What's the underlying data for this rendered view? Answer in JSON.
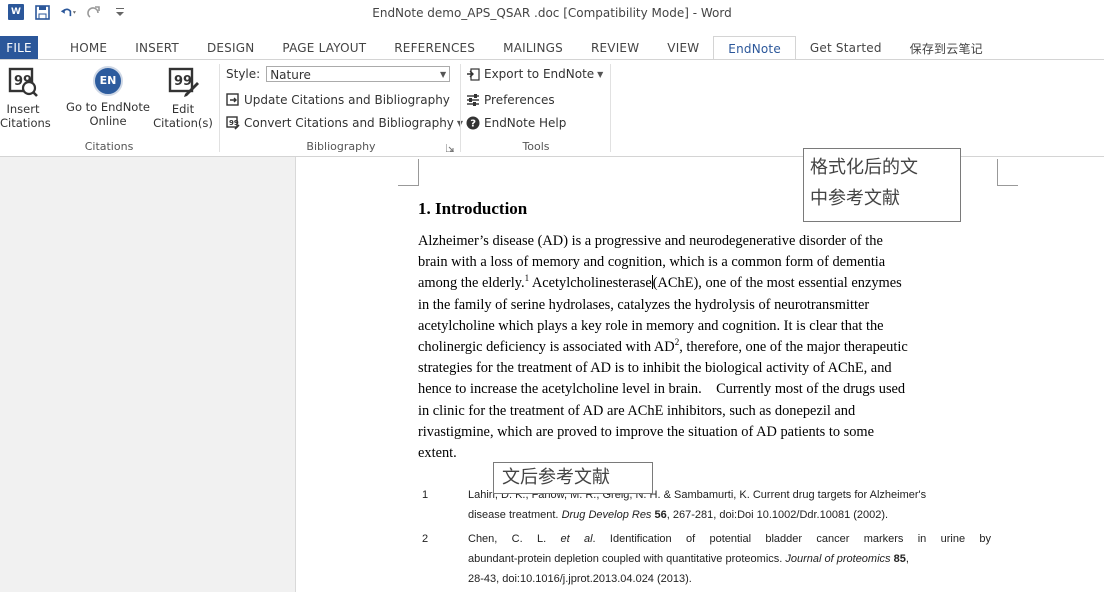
{
  "window": {
    "title": "EndNote demo_APS_QSAR .doc [Compatibility Mode] - Word",
    "app_badge": "W",
    "qat_icons": [
      "save-icon",
      "undo-icon",
      "redo-icon",
      "customize-icon"
    ]
  },
  "tabs": [
    {
      "label": "FILE"
    },
    {
      "label": "HOME"
    },
    {
      "label": "INSERT"
    },
    {
      "label": "DESIGN"
    },
    {
      "label": "PAGE LAYOUT"
    },
    {
      "label": "REFERENCES"
    },
    {
      "label": "MAILINGS"
    },
    {
      "label": "REVIEW"
    },
    {
      "label": "VIEW"
    },
    {
      "label": "EndNote"
    },
    {
      "label": "Get Started"
    },
    {
      "label": "保存到云笔记"
    }
  ],
  "active_tab": "EndNote",
  "ribbon": {
    "citations": {
      "group_label": "Citations",
      "insert": {
        "line1": "Insert",
        "line2": "Citations"
      },
      "goto": {
        "line1": "Go to EndNote",
        "line2": "Online",
        "badge": "EN"
      },
      "edit": {
        "line1": "Edit",
        "line2": "Citation(s)"
      }
    },
    "bibliography": {
      "group_label": "Bibliography",
      "style_label": "Style:",
      "style_value": "Nature",
      "update": "Update Citations and Bibliography",
      "convert": "Convert Citations and Bibliography"
    },
    "tools": {
      "group_label": "Tools",
      "export": "Export to EndNote",
      "preferences": "Preferences",
      "help": "EndNote Help"
    }
  },
  "document": {
    "heading": "1. Introduction",
    "paragraph": {
      "l1": "Alzheimer’s disease (AD) is a progressive and neurodegenerative disorder of the",
      "l2": "brain with a loss of memory and cognition, which is a common form of dementia",
      "l3a": "among the elderly.",
      "l3sup": "1",
      "l3b": " Acetylcholinesterase",
      "l3c": "(AChE), one of the most essential enzymes",
      "l4": "in the family of serine hydrolases, catalyzes the hydrolysis of neurotransmitter",
      "l5": "acetylcholine which plays a key role in memory and cognition. It is clear that the",
      "l6a": "cholinergic deficiency is associated with AD",
      "l6sup": "2",
      "l6b": ", therefore, one of the major therapeutic",
      "l7": "strategies for the treatment of AD is to inhibit the biological activity of AChE, and",
      "l8": "hence to increase the acetylcholine level in brain.    Currently most of the drugs used",
      "l9": "in clinic for the treatment of AD are AChE inhibitors, such as donepezil and",
      "l10": "rivastigmine, which are proved to improve the situation of AD patients to some",
      "l11": "extent."
    },
    "references": [
      {
        "num": "1",
        "line1": "Lahiri, D. K., Farlow, M. R., Greig, N. H. & Sambamurti, K. Current drug targets for Alzheimer's",
        "line2a": "disease treatment. ",
        "line2j": "Drug Develop Res",
        "line2v": " 56",
        "line2b": ", 267-281, doi:Doi 10.1002/Ddr.10081 (2002)."
      },
      {
        "num": "2",
        "line1a": "Chen, C. L. ",
        "line1i": "et al",
        "line1b": ". Identification of potential bladder cancer markers in urine by",
        "line2a": "abundant-protein depletion coupled with quantitative proteomics. ",
        "line2j": "Journal of proteomics",
        "line2v": " 85",
        "line2b": ",",
        "line3": "28-43, doi:10.1016/j.jprot.2013.04.024 (2013)."
      }
    ]
  },
  "annotations": {
    "formatted_citations": {
      "line1": "格式化后的文",
      "line2": "中参考文献"
    },
    "bibliography_label": "文后参考文献"
  },
  "colors": {
    "brand": "#2b579a",
    "nav_pane": "#f1f1f1"
  }
}
